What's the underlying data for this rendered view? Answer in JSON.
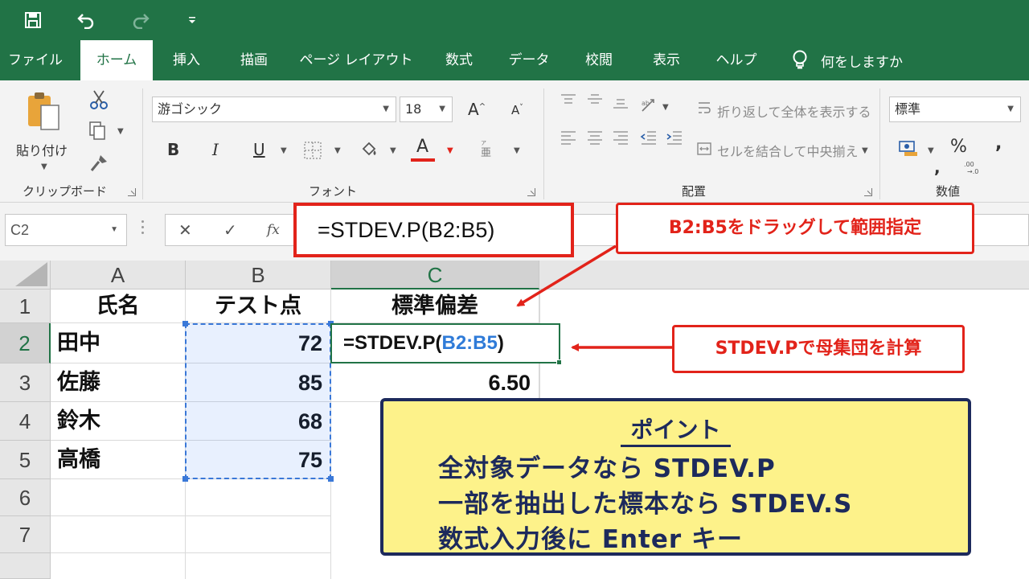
{
  "qat": {
    "icons": [
      "save-icon",
      "undo-icon",
      "redo-icon",
      "customize-qat-icon"
    ]
  },
  "tabs": [
    {
      "label": "ファイル",
      "active": false
    },
    {
      "label": "ホーム",
      "active": true
    },
    {
      "label": "挿入",
      "active": false
    },
    {
      "label": "描画",
      "active": false
    },
    {
      "label": "ページ レイアウト",
      "active": false
    },
    {
      "label": "数式",
      "active": false
    },
    {
      "label": "データ",
      "active": false
    },
    {
      "label": "校閲",
      "active": false
    },
    {
      "label": "表示",
      "active": false
    },
    {
      "label": "ヘルプ",
      "active": false
    }
  ],
  "tell_me": "何をしますか",
  "ribbon": {
    "clipboard": {
      "paste_label": "貼り付け",
      "group_label": "クリップボード"
    },
    "font": {
      "font_name": "游ゴシック",
      "font_size": "18",
      "bold": "B",
      "italic": "I",
      "underline": "U",
      "font_color_letter": "A",
      "grow_letter": "A",
      "shrink_letter": "A",
      "group_label": "フォント",
      "font_color": "#e2231a"
    },
    "alignment": {
      "wrap_text": "折り返して全体を表示する",
      "merge_center": "セルを結合して中央揃え",
      "group_label": "配置"
    },
    "number": {
      "format": "標準",
      "percent": "%",
      "comma": ",",
      "comma2": ",",
      "group_label": "数値"
    }
  },
  "formula_bar": {
    "name_box": "C2",
    "cancel": "✕",
    "enter": "✓",
    "fx": "fx",
    "formula": "=STDEV.P(B2:B5)"
  },
  "sheet": {
    "columns": [
      "A",
      "B",
      "C"
    ],
    "selected_column": "C",
    "rows": [
      "1",
      "2",
      "3",
      "4",
      "5",
      "6",
      "7"
    ],
    "selected_row": "2",
    "headers": {
      "A": "氏名",
      "B": "テスト点",
      "C": "標準偏差"
    },
    "data": [
      {
        "name": "田中",
        "score": "72"
      },
      {
        "name": "佐藤",
        "score": "85"
      },
      {
        "name": "鈴木",
        "score": "68"
      },
      {
        "name": "高橋",
        "score": "75"
      }
    ],
    "active_cell": {
      "prefix": "=STDEV.P(",
      "ref": "B2:B5",
      "suffix": ")"
    },
    "c3_value": "6.50"
  },
  "callouts": {
    "range": "B2:B5をドラッグして範囲指定",
    "function": "STDEV.Pで母集団を計算"
  },
  "point": {
    "title": "ポイント",
    "lines": [
      "全対象データなら STDEV.P",
      "一部を抽出した標本なら STDEV.S",
      "数式入力後に Enter キー"
    ]
  },
  "colors": {
    "excel_green": "#217346",
    "accent_red": "#e2231a",
    "note_yellow": "#fdf28a",
    "note_border": "#1d2a5c",
    "range_blue": "#2f7bd8"
  }
}
